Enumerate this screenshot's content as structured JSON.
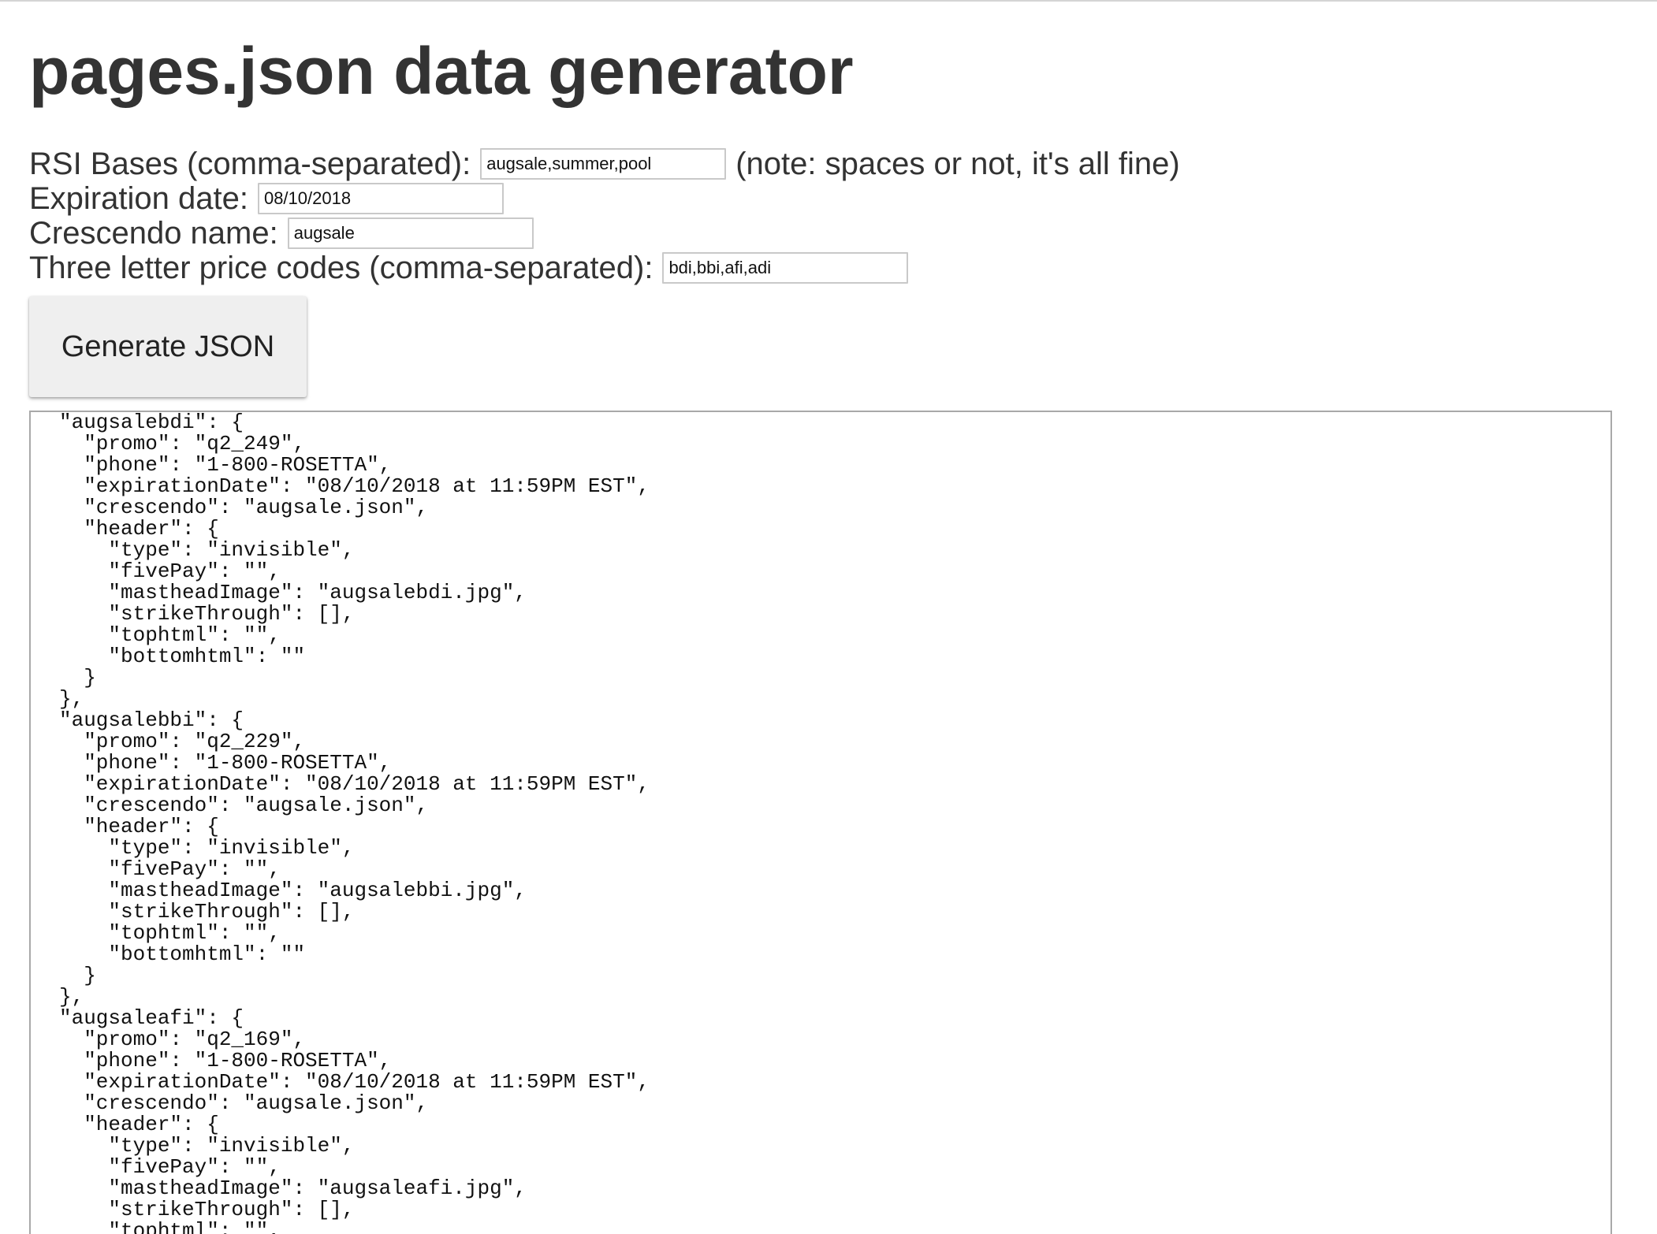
{
  "page": {
    "title": "pages.json data generator"
  },
  "form": {
    "rsi_bases": {
      "label": "RSI Bases (comma-separated):",
      "value": "augsale,summer,pool",
      "note": "(note: spaces or not, it's all fine)"
    },
    "expiration_date": {
      "label": "Expiration date:",
      "value": "08/10/2018"
    },
    "crescendo_name": {
      "label": "Crescendo name:",
      "value": "augsale"
    },
    "price_codes": {
      "label": "Three letter price codes (comma-separated):",
      "value": "bdi,bbi,afi,adi"
    }
  },
  "actions": {
    "generate_label": "Generate JSON"
  },
  "output": {
    "text": "\"augsalebdi\": {\n  \"promo\": \"q2_249\",\n  \"phone\": \"1-800-ROSETTA\",\n  \"expirationDate\": \"08/10/2018 at 11:59PM EST\",\n  \"crescendo\": \"augsale.json\",\n  \"header\": {\n    \"type\": \"invisible\",\n    \"fivePay\": \"\",\n    \"mastheadImage\": \"augsalebdi.jpg\",\n    \"strikeThrough\": [],\n    \"tophtml\": \"\",\n    \"bottomhtml\": \"\"\n  }\n},\n\"augsalebbi\": {\n  \"promo\": \"q2_229\",\n  \"phone\": \"1-800-ROSETTA\",\n  \"expirationDate\": \"08/10/2018 at 11:59PM EST\",\n  \"crescendo\": \"augsale.json\",\n  \"header\": {\n    \"type\": \"invisible\",\n    \"fivePay\": \"\",\n    \"mastheadImage\": \"augsalebbi.jpg\",\n    \"strikeThrough\": [],\n    \"tophtml\": \"\",\n    \"bottomhtml\": \"\"\n  }\n},\n\"augsaleafi\": {\n  \"promo\": \"q2_169\",\n  \"phone\": \"1-800-ROSETTA\",\n  \"expirationDate\": \"08/10/2018 at 11:59PM EST\",\n  \"crescendo\": \"augsale.json\",\n  \"header\": {\n    \"type\": \"invisible\",\n    \"fivePay\": \"\",\n    \"mastheadImage\": \"augsaleafi.jpg\",\n    \"strikeThrough\": [],\n    \"tophtml\": \"\","
  }
}
